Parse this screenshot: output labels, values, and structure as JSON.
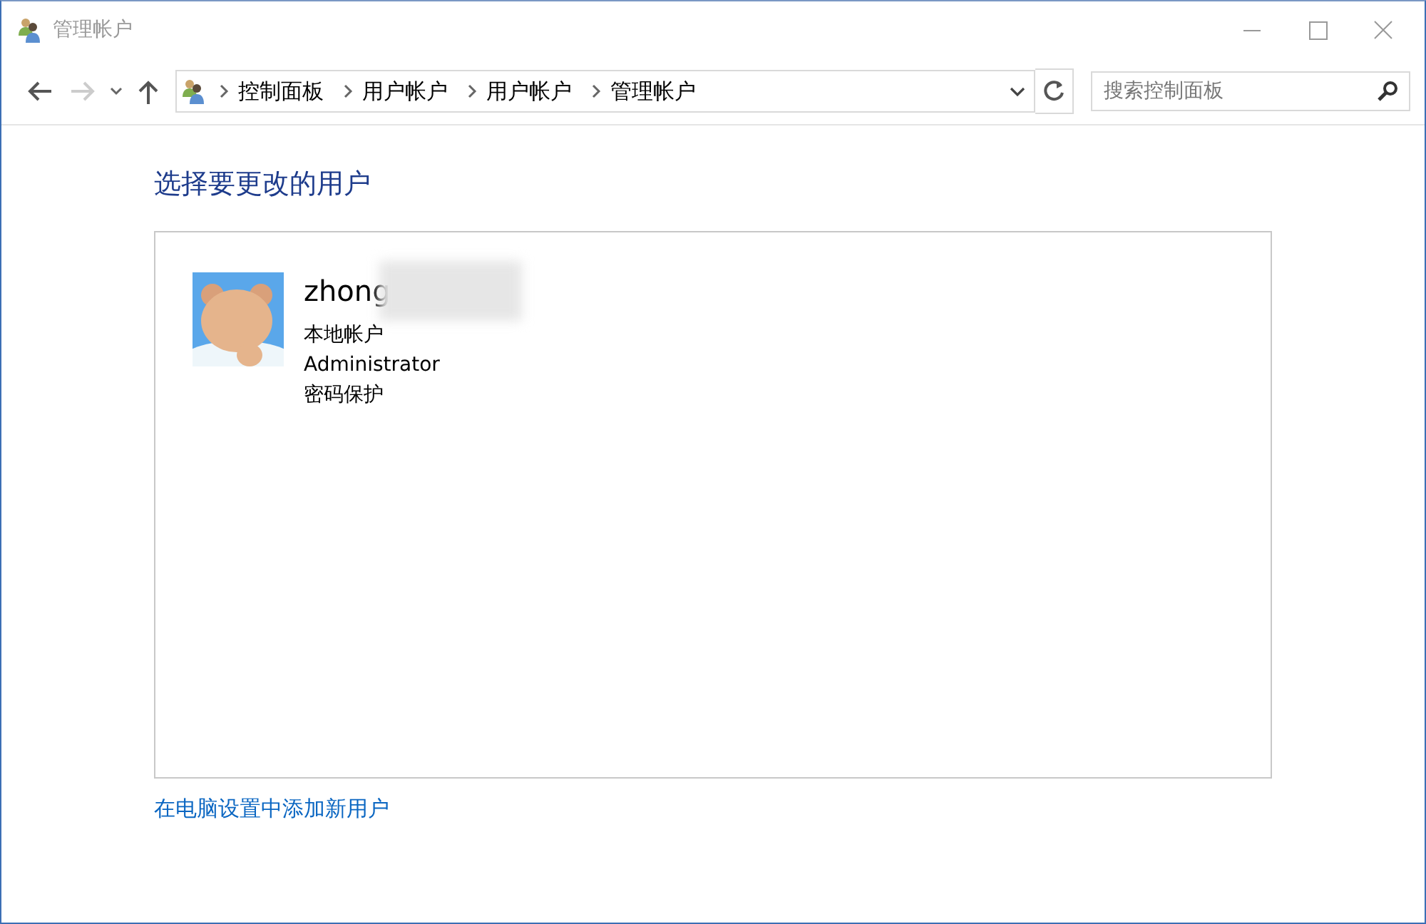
{
  "window": {
    "title": "管理帐户"
  },
  "navigation": {
    "back_disabled": false,
    "forward_disabled": true
  },
  "address_bar": {
    "crumbs": [
      "控制面板",
      "用户帐户",
      "用户帐户",
      "管理帐户"
    ]
  },
  "search": {
    "placeholder": "搜索控制面板"
  },
  "heading": "选择要更改的用户",
  "accounts": [
    {
      "name": "zhong",
      "type": "本地帐户",
      "role": "Administrator",
      "protection": "密码保护",
      "name_blurred": true
    }
  ],
  "add_user_link": "在电脑设置中添加新用户"
}
